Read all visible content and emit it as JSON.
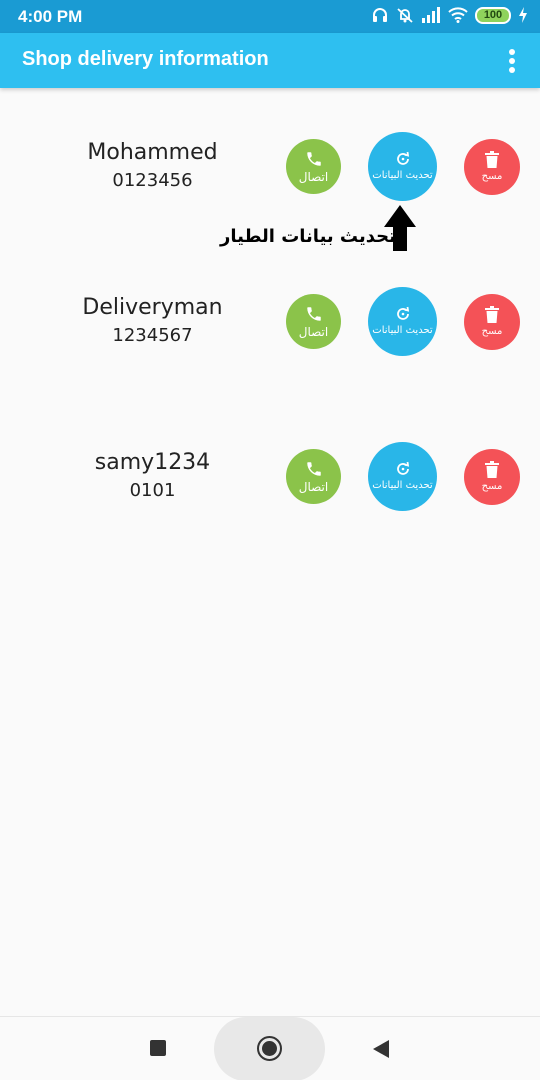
{
  "status_bar": {
    "time": "4:00 PM",
    "battery": "100",
    "icons": [
      "headphones-icon",
      "bell-off-icon",
      "signal-icon",
      "wifi-icon",
      "battery-icon",
      "charging-icon"
    ]
  },
  "app_bar": {
    "title": "Shop delivery information",
    "menu_icon": "more-vert-icon"
  },
  "delivery_list": [
    {
      "name": "Mohammed",
      "phone": "0123456"
    },
    {
      "name": "Deliveryman",
      "phone": "1234567"
    },
    {
      "name": "samy1234",
      "phone": "0101"
    }
  ],
  "actions": {
    "call_label": "اتصال",
    "update_label": "تحديث البيانات",
    "delete_label": "مسح"
  },
  "annotation": {
    "text": "تحديث بيانات الطيار"
  },
  "colors": {
    "status_bar": "#1a9bd3",
    "app_bar": "#2ebff0",
    "call": "#8bc34a",
    "update": "#29b6e8",
    "delete": "#f45257",
    "background": "#fafafa"
  }
}
